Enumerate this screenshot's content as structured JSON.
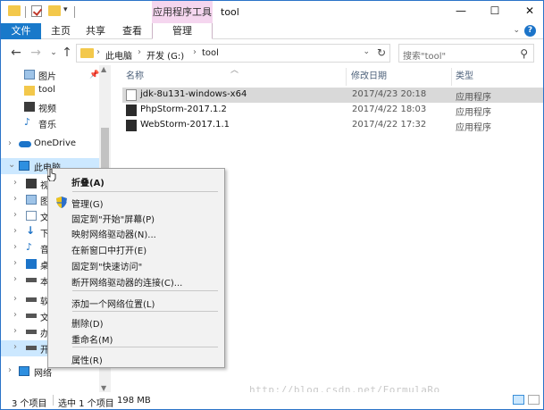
{
  "titlebar": {
    "contextual_group": "应用程序工具",
    "title": "tool",
    "minimize": "—",
    "maximize": "☐",
    "close": "✕"
  },
  "ribbon": {
    "tabs": [
      "文件",
      "主页",
      "共享",
      "查看",
      "管理"
    ]
  },
  "address": {
    "crumbs": [
      "此电脑",
      "开发 (G:)",
      "tool"
    ],
    "search_placeholder": "搜索\"tool\""
  },
  "nav": {
    "items": [
      {
        "label": "图片",
        "icon": "pictures-icon",
        "pinned": true
      },
      {
        "label": "tool",
        "icon": "folder-icon"
      },
      {
        "label": "视频",
        "icon": "videos-icon"
      },
      {
        "label": "音乐",
        "icon": "music-icon"
      },
      {
        "label": "OneDrive",
        "icon": "onedrive-icon"
      },
      {
        "label": "此电脑",
        "icon": "this-pc-icon"
      },
      {
        "label": "视",
        "icon": "videos-icon"
      },
      {
        "label": "图",
        "icon": "pictures-icon"
      },
      {
        "label": "文",
        "icon": "documents-icon"
      },
      {
        "label": "下",
        "icon": "downloads-icon"
      },
      {
        "label": "音",
        "icon": "music-icon"
      },
      {
        "label": "桌",
        "icon": "desktop-icon"
      },
      {
        "label": "本",
        "icon": "drive-icon"
      },
      {
        "label": "软",
        "icon": "drive-icon"
      },
      {
        "label": "文",
        "icon": "drive-icon"
      },
      {
        "label": "办",
        "icon": "drive-icon"
      },
      {
        "label": "开",
        "icon": "drive-icon"
      },
      {
        "label": "网络",
        "icon": "network-icon"
      }
    ]
  },
  "list": {
    "columns": [
      "名称",
      "修改日期",
      "类型"
    ],
    "rows": [
      {
        "name": "jdk-8u131-windows-x64",
        "date": "2017/4/23 20:18",
        "type": "应用程序"
      },
      {
        "name": "PhpStorm-2017.1.2",
        "date": "2017/4/22 18:03",
        "type": "应用程序"
      },
      {
        "name": "WebStorm-2017.1.1",
        "date": "2017/4/22 17:32",
        "type": "应用程序"
      }
    ]
  },
  "status": {
    "count": "3 个项目",
    "selected": "选中 1 个项目",
    "size": "198 MB"
  },
  "watermark": "http://blog.csdn.net/FormulaRo",
  "context_menu": {
    "items": [
      {
        "label": "折叠(A)",
        "bold": true
      },
      {
        "label": "管理(G)",
        "icon": "shield-icon"
      },
      {
        "label": "固定到\"开始\"屏幕(P)"
      },
      {
        "label": "映射网络驱动器(N)..."
      },
      {
        "label": "在新窗口中打开(E)"
      },
      {
        "label": "固定到\"快速访问\""
      },
      {
        "label": "断开网络驱动器的连接(C)..."
      },
      {
        "label": "添加一个网络位置(L)"
      },
      {
        "label": "删除(D)"
      },
      {
        "label": "重命名(M)"
      },
      {
        "label": "属性(R)"
      }
    ]
  }
}
